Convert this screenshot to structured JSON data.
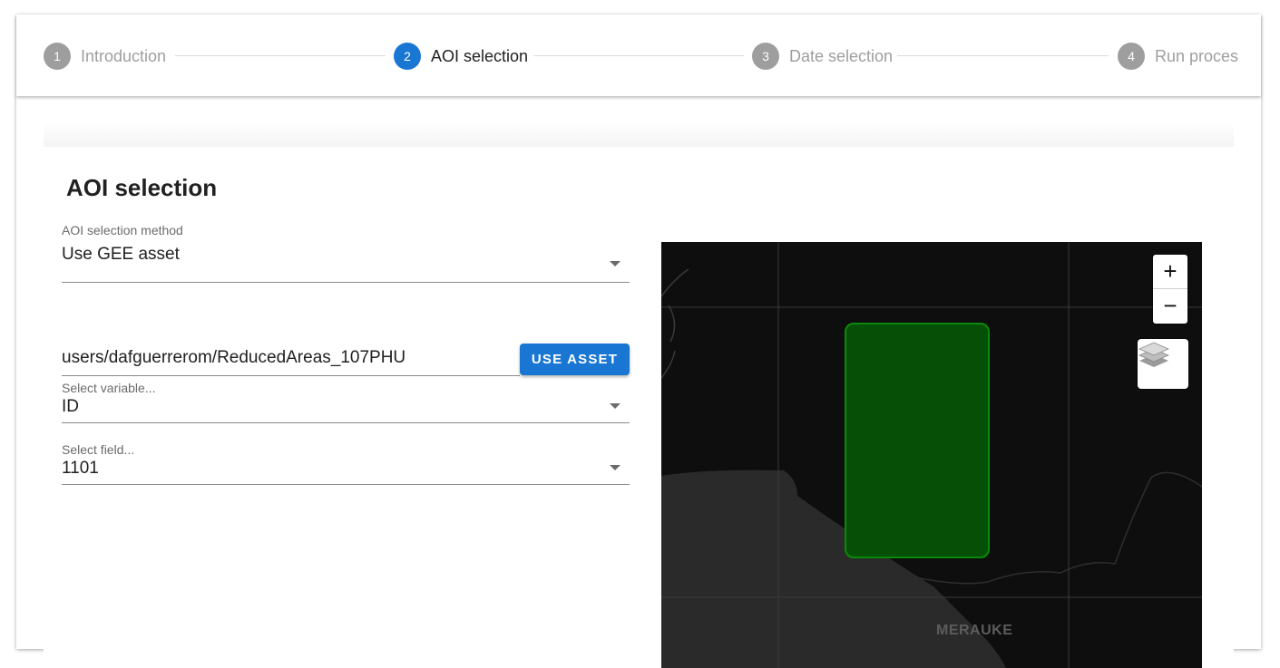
{
  "stepper": {
    "steps": [
      {
        "number": "1",
        "label": "Introduction"
      },
      {
        "number": "2",
        "label": "AOI selection"
      },
      {
        "number": "3",
        "label": "Date selection"
      },
      {
        "number": "4",
        "label": "Run proces"
      }
    ],
    "active_step": 2
  },
  "section": {
    "title": "AOI selection"
  },
  "aoi_method": {
    "label": "AOI selection method",
    "value": "Use GEE asset"
  },
  "asset": {
    "value": "users/dafguerrerom/ReducedAreas_107PHU",
    "button_label": "USE ASSET"
  },
  "variable_select": {
    "label": "Select variable...",
    "value": "ID"
  },
  "field_select": {
    "label": "Select field...",
    "value": "1101"
  },
  "map": {
    "zoom_in": "+",
    "zoom_out": "−",
    "place_label": "MERAUKE",
    "aoi_fill_color": "#064f06",
    "aoi_stroke_color": "#0a8a0a"
  },
  "colors": {
    "accent": "#1976d2",
    "inactive_step": "#9e9e9e"
  }
}
